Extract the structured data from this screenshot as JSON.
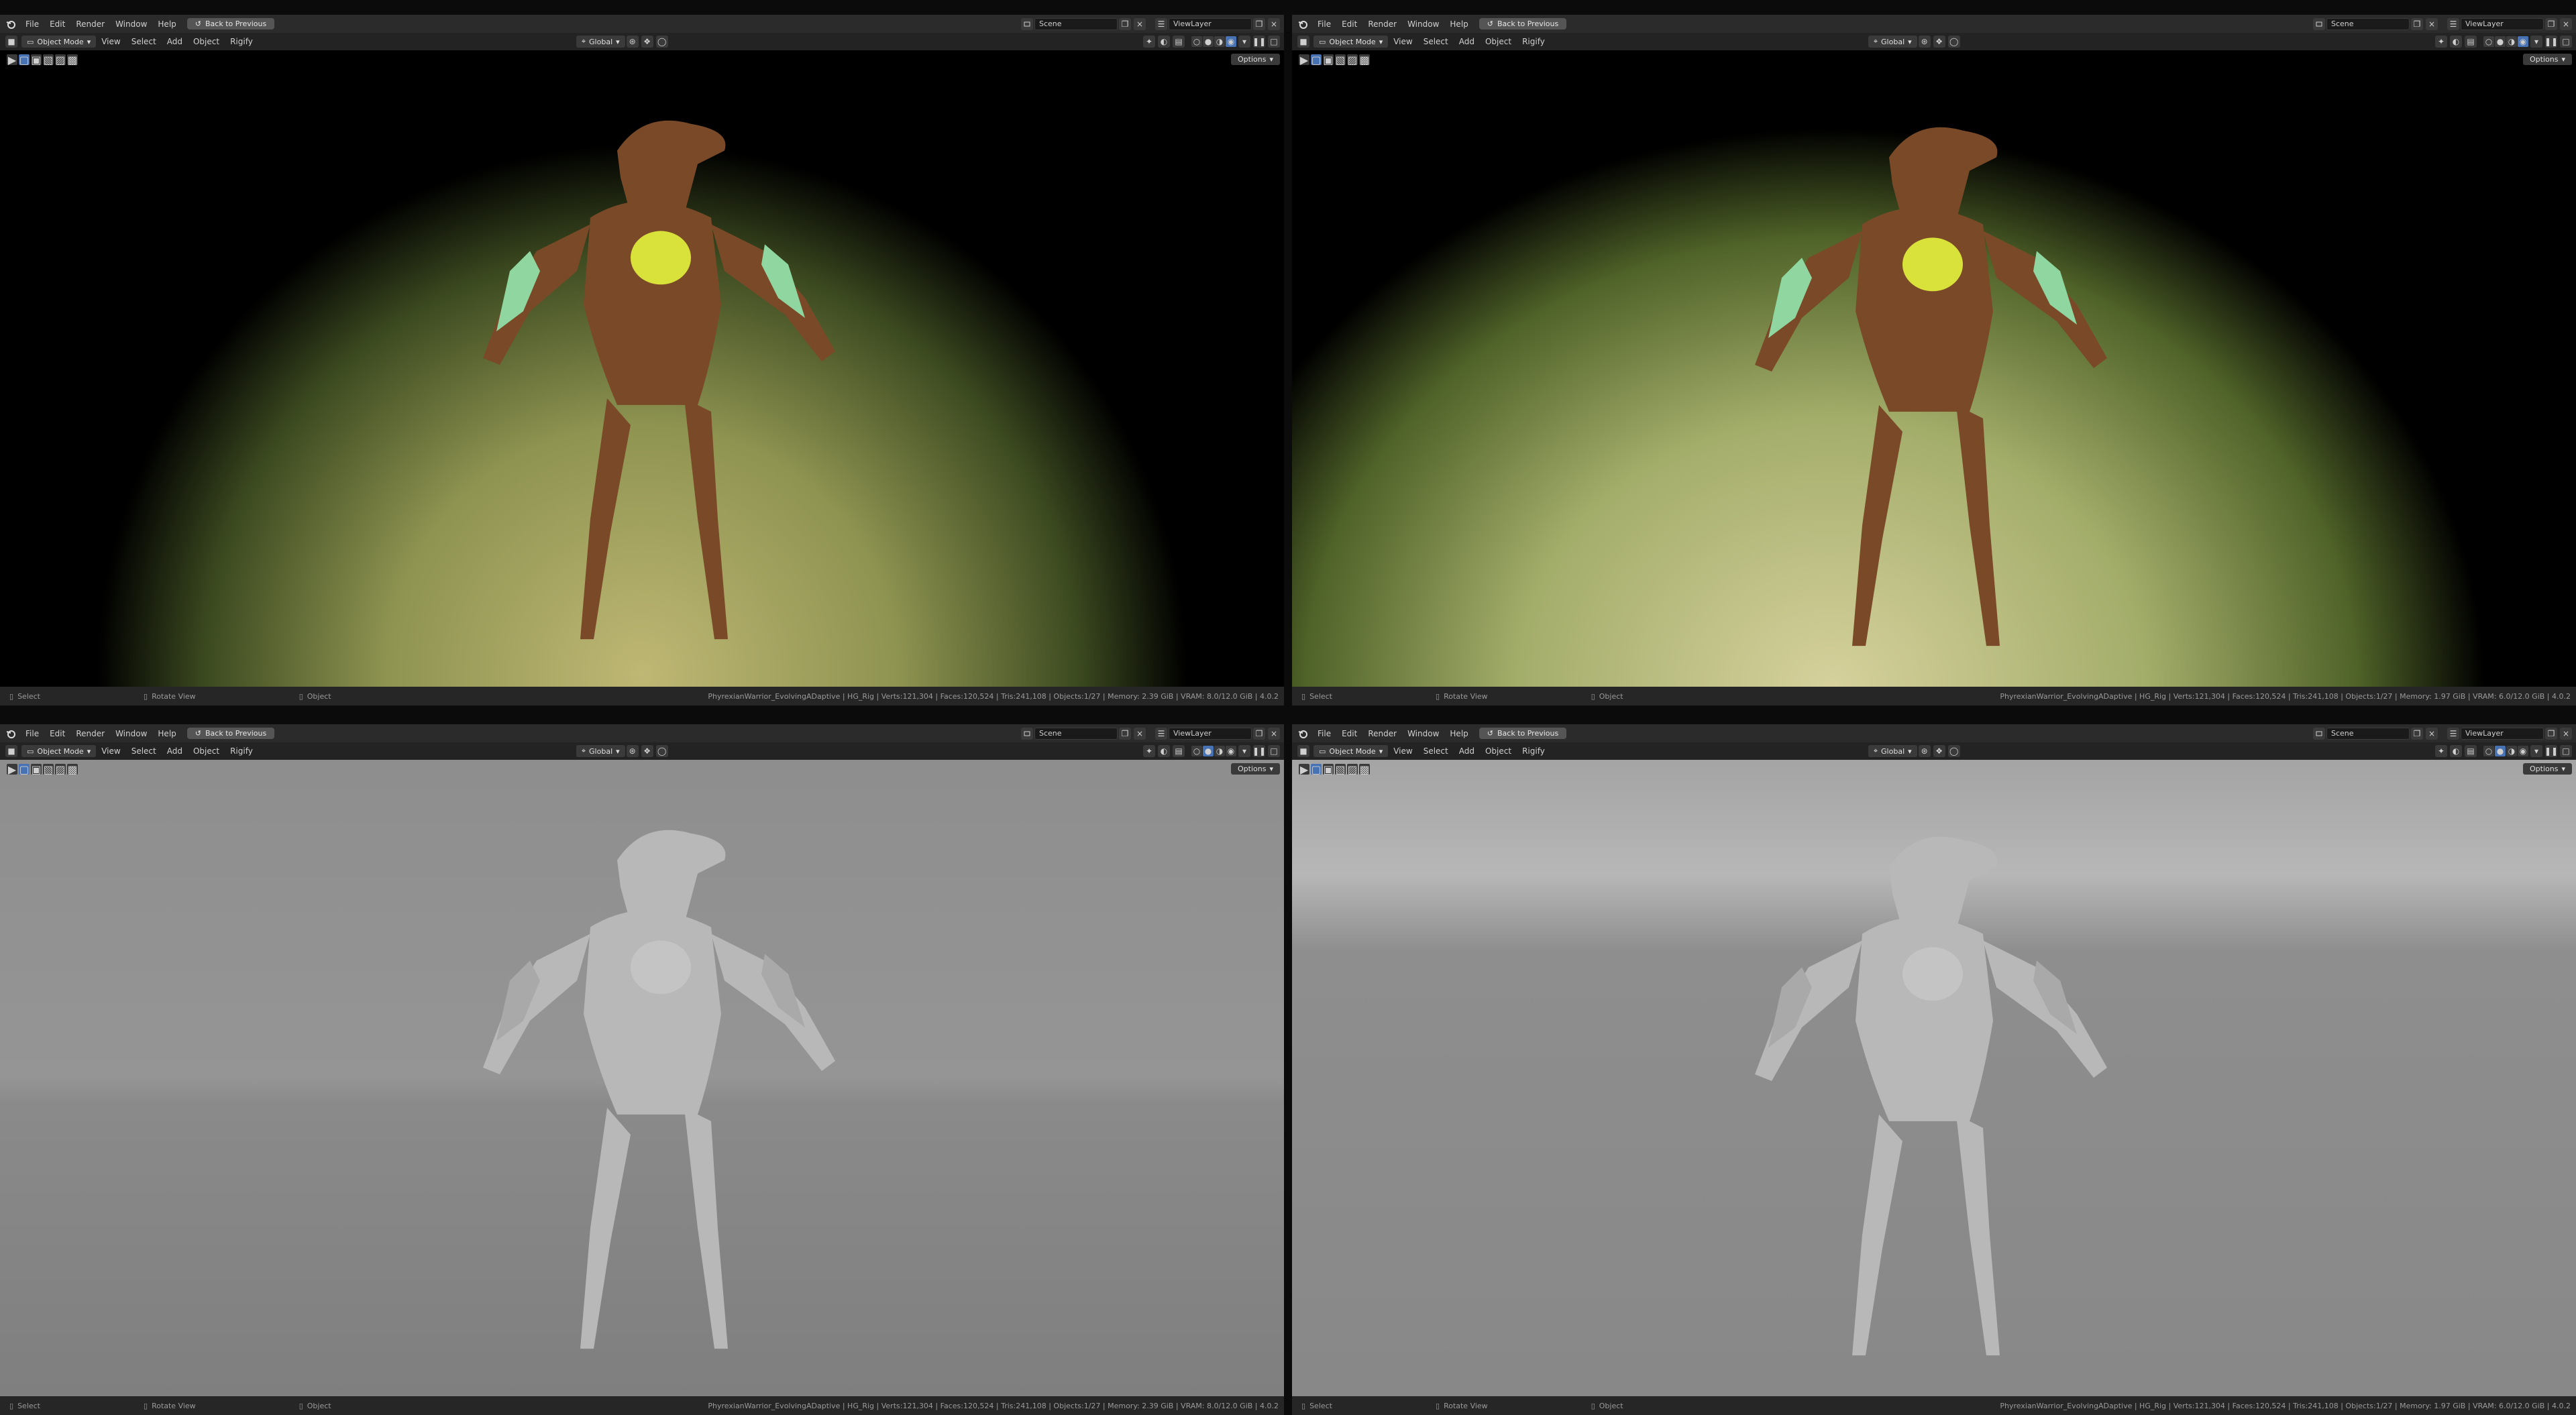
{
  "menus": [
    "File",
    "Edit",
    "Render",
    "Window",
    "Help"
  ],
  "back_button": "Back to Previous",
  "scene": "Scene",
  "view_layer": "ViewLayer",
  "header": {
    "mode": "Object Mode",
    "items": [
      "View",
      "Select",
      "Add",
      "Object",
      "Rigify"
    ],
    "orientation": "Global"
  },
  "options_label": "Options",
  "status": {
    "select": "Select",
    "rotate": "Rotate View",
    "object": "Object"
  },
  "panes": [
    {
      "id": "top-left",
      "shading": "rendered",
      "stats": "PhyrexianWarrior_EvolvingADaptive | HG_Rig | Verts:121,304 | Faces:120,524 | Tris:241,108 | Objects:1/27 | Memory: 2.39 GiB | VRAM: 8.0/12.0 GiB | 4.0.2"
    },
    {
      "id": "top-right",
      "shading": "rendered",
      "stats": "PhyrexianWarrior_EvolvingADaptive | HG_Rig | Verts:121,304 | Faces:120,524 | Tris:241,108 | Objects:1/27 | Memory: 1.97 GiB | VRAM: 6.0/12.0 GiB | 4.0.2"
    },
    {
      "id": "bottom-left",
      "shading": "solid",
      "stats": "PhyrexianWarrior_EvolvingADaptive | HG_Rig | Verts:121,304 | Faces:120,524 | Tris:241,108 | Objects:1/27 | Memory: 2.39 GiB | VRAM: 8.0/12.0 GiB | 4.0.2"
    },
    {
      "id": "bottom-right",
      "shading": "solid",
      "stats": "PhyrexianWarrior_EvolvingADaptive | HG_Rig | Verts:121,304 | Faces:120,524 | Tris:241,108 | Objects:1/27 | Memory: 1.97 GiB | VRAM: 6.0/12.0 GiB | 4.0.2"
    }
  ],
  "colors": {
    "accent": "#4772b3",
    "render_figure_body": "#7a4a28",
    "render_figure_glow": "#d9e23a",
    "render_figure_fins": "#8fd6a0",
    "solid_figure": "#b8b8b8"
  },
  "icons": [
    "blender-logo-icon",
    "search-icon",
    "scene-icon",
    "view-layer-icon",
    "copy-icon",
    "close-icon",
    "mode-icon",
    "orientation-icon",
    "pivot-icon",
    "snap-icon",
    "proportional-icon",
    "overlay-icon",
    "xray-icon",
    "mouse-left-icon",
    "mouse-middle-icon",
    "mouse-right-icon",
    "chevron-down-icon"
  ]
}
